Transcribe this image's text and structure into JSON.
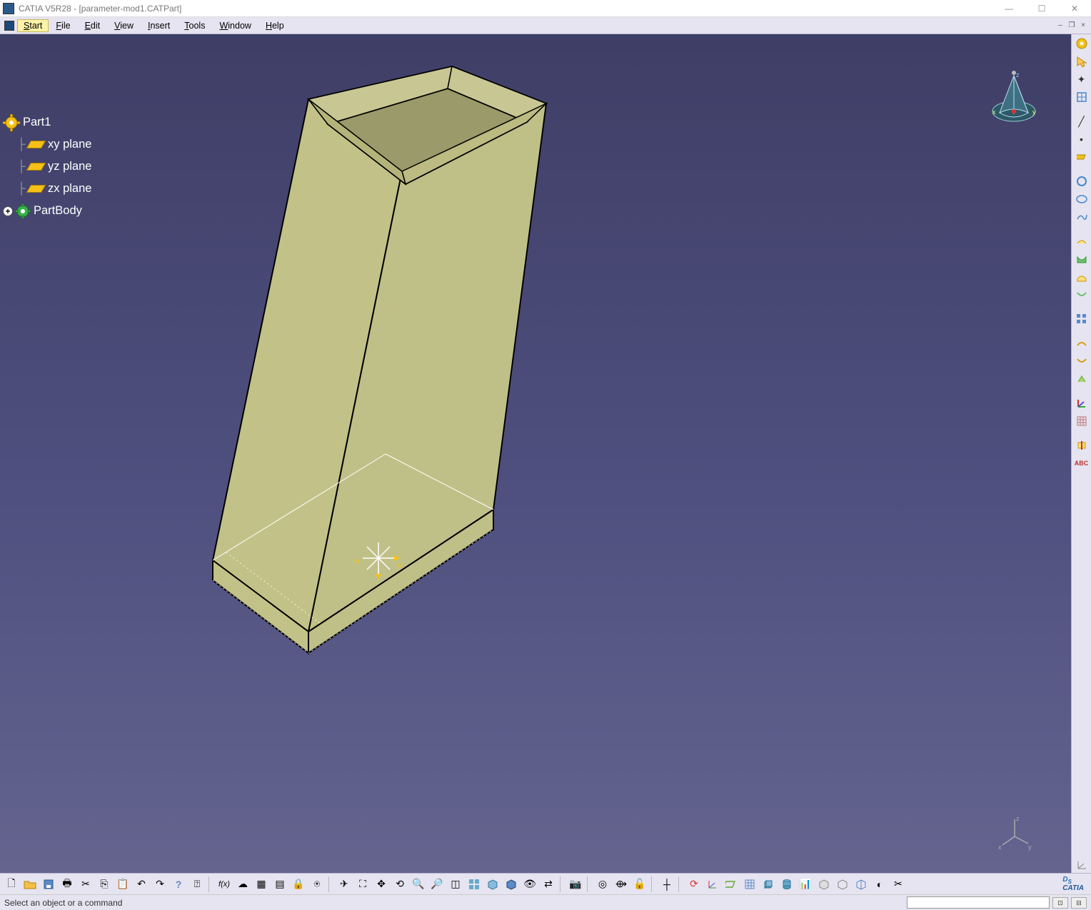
{
  "title": "CATIA V5R28 - [parameter-mod1.CATPart]",
  "window_controls": {
    "min": "—",
    "max": "☐",
    "close": "✕"
  },
  "doc_controls": {
    "min": "–",
    "restore": "❐",
    "close": "×"
  },
  "menu": {
    "start": "Start",
    "file": "File",
    "edit": "Edit",
    "view": "View",
    "insert": "Insert",
    "tools": "Tools",
    "window": "Window",
    "help": "Help"
  },
  "tree": {
    "root": "Part1",
    "plane_xy": "xy plane",
    "plane_yz": "yz plane",
    "plane_zx": "zx plane",
    "partbody": "PartBody"
  },
  "compass": {
    "x": "x",
    "y": "y",
    "z": "z"
  },
  "triad": {
    "x": "x",
    "y": "y",
    "z": "z"
  },
  "origin_labels": {
    "h": "H",
    "v": "V"
  },
  "status": {
    "prompt": "Select an object or a command",
    "input_value": ""
  },
  "right_toolbar": {
    "icons": [
      "workbench",
      "select",
      "axis-edit",
      "sketch",
      "line",
      "text",
      "rectangle",
      "circle",
      "ellipse",
      "spline",
      "advanced",
      "pocket",
      "pad",
      "shaft",
      "groove",
      "pattern",
      "mirror",
      "fillet",
      "chamfer",
      "draft",
      "scale",
      "hole",
      "thickness",
      "shell",
      "abc",
      "separator",
      "triad"
    ]
  },
  "bottom_toolbar": {
    "icons": [
      "new",
      "open",
      "save",
      "print",
      "cut",
      "copy",
      "paste",
      "undo",
      "redo",
      "help",
      "what",
      "fx",
      "connect",
      "p1",
      "table",
      "lock",
      "p2",
      "sep",
      "fly",
      "fit",
      "pan",
      "rotate",
      "look",
      "zoom-area",
      "zoom",
      "normal",
      "multi",
      "iso",
      "shading",
      "hide",
      "swap",
      "sep",
      "print2",
      "sep",
      "center",
      "snap",
      "lock2",
      "sep",
      "axis",
      "sep",
      "update",
      "axis2",
      "plane",
      "grid",
      "cube",
      "cyl",
      "sphere",
      "hlr",
      "shade",
      "wire",
      "bound",
      "clip"
    ]
  }
}
